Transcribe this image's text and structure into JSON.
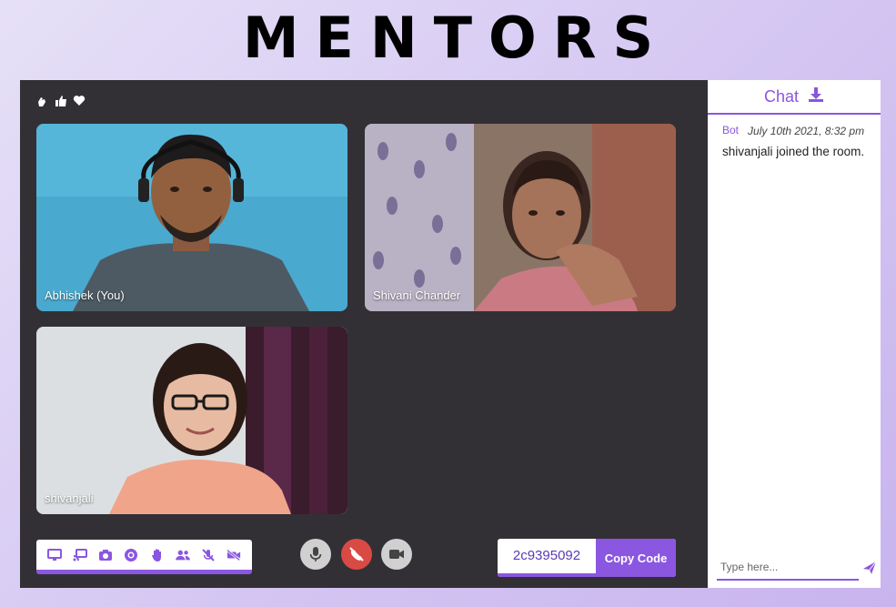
{
  "app": {
    "title": "MENTORS"
  },
  "reactions": [
    "clap-icon",
    "thumbs-up-icon",
    "heart-icon"
  ],
  "participants": [
    {
      "name": "Abhishek (You)",
      "bg": "#4fb0d4"
    },
    {
      "name": "Shivani Chander",
      "bg": "#6b5a52"
    },
    {
      "name": "shivanjali",
      "bg": "#d9dcde"
    }
  ],
  "controls": {
    "toolbar_icons": [
      "screen-share-icon",
      "cast-icon",
      "camera-icon",
      "record-icon",
      "raise-hand-icon",
      "participants-icon",
      "mute-all-icon",
      "video-off-all-icon"
    ],
    "mic_icon": "microphone-icon",
    "end_call_icon": "end-call-icon",
    "video_icon": "video-camera-icon"
  },
  "room": {
    "code": "2c9395092",
    "copy_label": "Copy Code"
  },
  "chat": {
    "title": "Chat",
    "download_icon": "download-icon",
    "messages": [
      {
        "author": "Bot",
        "time": "July 10th 2021, 8:32 pm",
        "text": "shivanjali joined the room."
      }
    ],
    "input_placeholder": "Type here...",
    "send_icon": "send-icon"
  },
  "colors": {
    "accent": "#8b56e0",
    "stage": "#333035",
    "end_call": "#d94a45"
  }
}
